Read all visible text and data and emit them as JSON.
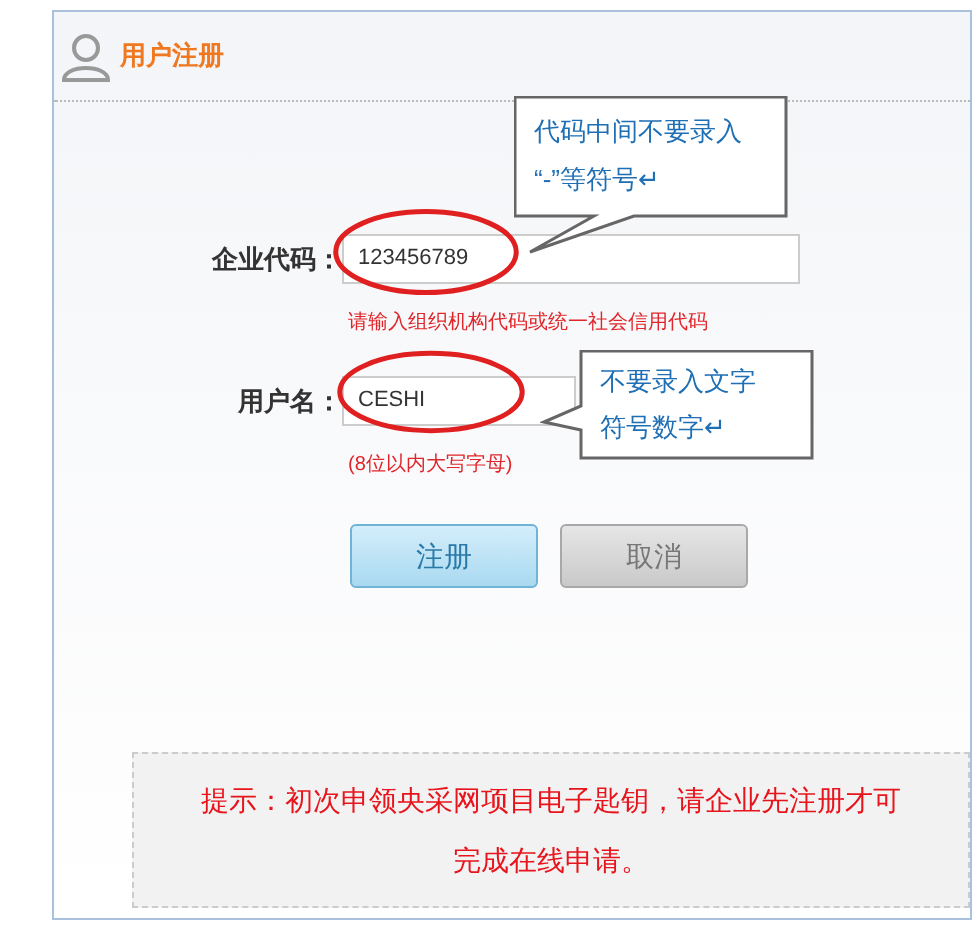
{
  "header": {
    "title": "用户注册"
  },
  "fields": [
    {
      "label": "企业代码：",
      "value": "123456789",
      "hint": "请输入组织机构代码或统一社会信用代码"
    },
    {
      "label": "用户名：",
      "value": "CESHI",
      "hint": "(8位以内大写字母)"
    }
  ],
  "callouts": [
    {
      "lines": [
        "代码中间不要录入",
        "“-”等符号↵"
      ]
    },
    {
      "lines": [
        "不要录入文字",
        "符号数字↵"
      ]
    }
  ],
  "buttons": [
    {
      "label": "注册",
      "kind": "primary"
    },
    {
      "label": "取消",
      "kind": "secondary"
    }
  ],
  "notice": "提示：初次申领央采网项目电子匙钥，请企业先注册才可完成在线申请。"
}
